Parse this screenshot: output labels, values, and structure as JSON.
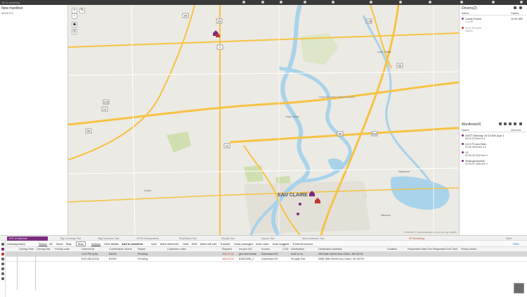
{
  "topbar": {
    "search_placeholder": "Go to anything"
  },
  "left_panel": {
    "title": "New manifest",
    "stats": "00:00 0 0"
  },
  "map": {
    "zoom_in": "+",
    "zoom_out": "−",
    "city_label": "EAU CLAIRE",
    "places": [
      "Lake Hallie",
      "Chippewa Valley Regional Airport",
      "Eau Claire",
      "Seymour",
      "Altoona",
      "Union"
    ],
    "roads": [
      "29",
      "178",
      "123",
      "53",
      "53",
      "12",
      "12",
      "59",
      "37",
      "312",
      "T",
      "29",
      "124",
      "53"
    ],
    "attribution": "© MAPBOX  © OpenStreetMap  Improve this map  TERMS"
  },
  "drivers": {
    "title": "Drivers(2)",
    "col_name": "Name",
    "col_status": "Status",
    "rows": [
      {
        "name": "Landy Evans",
        "role": "Courier",
        "status": "11:52 AM",
        "color": "#8e44ad"
      },
      {
        "name": "Kevin Racinels",
        "role": "Station",
        "status": "",
        "color": "#c0392b"
      }
    ]
  },
  "manifests": {
    "title": "Manifests(4)",
    "col_name": "Name",
    "col_queued": "Queued",
    "rows": [
      {
        "name": "EAST Monday 10:15 AM (Apr 1",
        "detail": "06:16 203.6mi 5 4",
        "color": "#7a2d7e"
      },
      {
        "name": "LOX Fri and Mon",
        "detail": "20:46 2464.5mi 5 0",
        "color": "#7a2d7e"
      },
      {
        "name": "V1",
        "detail": "02:03:45 2263.5mi 0",
        "color": "#7a2d7e"
      },
      {
        "name": "Testing/couriers",
        "detail": "02:03:21 2269.5mi 0",
        "color": "#7a2d7e"
      }
    ]
  },
  "tabs": [
    {
      "label": "ATC of unknown",
      "active": true
    },
    {
      "label": "Big Concierge Taxi"
    },
    {
      "label": "BigCommerce Taxi"
    },
    {
      "label": "BYPA Headquarters"
    },
    {
      "label": "ShipStation Taxi"
    },
    {
      "label": "Shopify Taxi"
    },
    {
      "label": "Square Taxi"
    },
    {
      "label": "WooCommerce Taxi"
    },
    {
      "label": "HP Monitoring",
      "red": true
    },
    {
      "label": "Sailer"
    }
  ],
  "toolbar": {
    "unassigned": "Unassigned(2)",
    "select": "Select:",
    "all": "All",
    "none": "None",
    "map": "Map",
    "map_checkbox": "Map",
    "actions": "Actions",
    "view_details": "View details",
    "add_to_manifest": "Add to manifest",
    "void": "Void",
    "mark_delivered": "Mark delivered",
    "hold": "Hold",
    "edit": "Edit",
    "mark_will_call": "Mark will call",
    "transfer": "Transfer",
    "scan_packages": "Scan packages",
    "auto_route": "Auto route",
    "auto_suggest": "Auto suggest",
    "external_service": "External service",
    "filter": "Filter:"
  },
  "columns": [
    "Driving Time",
    "Driving Dist",
    "Priority code",
    "Ordered At",
    "Confirmation Numb",
    "Status",
    "Customer notes",
    "Elapsed",
    "Invoice NO",
    "Source",
    "COD",
    "Destination",
    "Destination Address",
    "Duration",
    "Requested Start Tim",
    "Requested End Time",
    "Pickup Notes"
  ],
  "rows": [
    {
      "ordered_at": "2:12 PM (4/5)",
      "confirmation": "82033",
      "status": "Pending",
      "elapsed": "150:21:41",
      "invoice": "geo-test-rental",
      "source": "Downtown EC",
      "destination": "Auto is on",
      "address": "100 Main Street Eau Claire, WI 54701",
      "selected": true
    },
    {
      "ordered_at": "9:00 AM (2/19)",
      "confirmation": "81990",
      "status": "Pending",
      "elapsed": "164:02:02",
      "invoice": "81867655_1",
      "source": "Downtown EC",
      "destination": "Shopify Taxi",
      "address": "2985 38th Street Eau Claire, WI 54703",
      "selected": false
    }
  ],
  "colors": {
    "accent": "#7a2d7e",
    "elapsed_red": "#c0392b",
    "road_yellow": "#f6c343",
    "water": "#a8d3ea",
    "park": "#cfdfb0"
  }
}
